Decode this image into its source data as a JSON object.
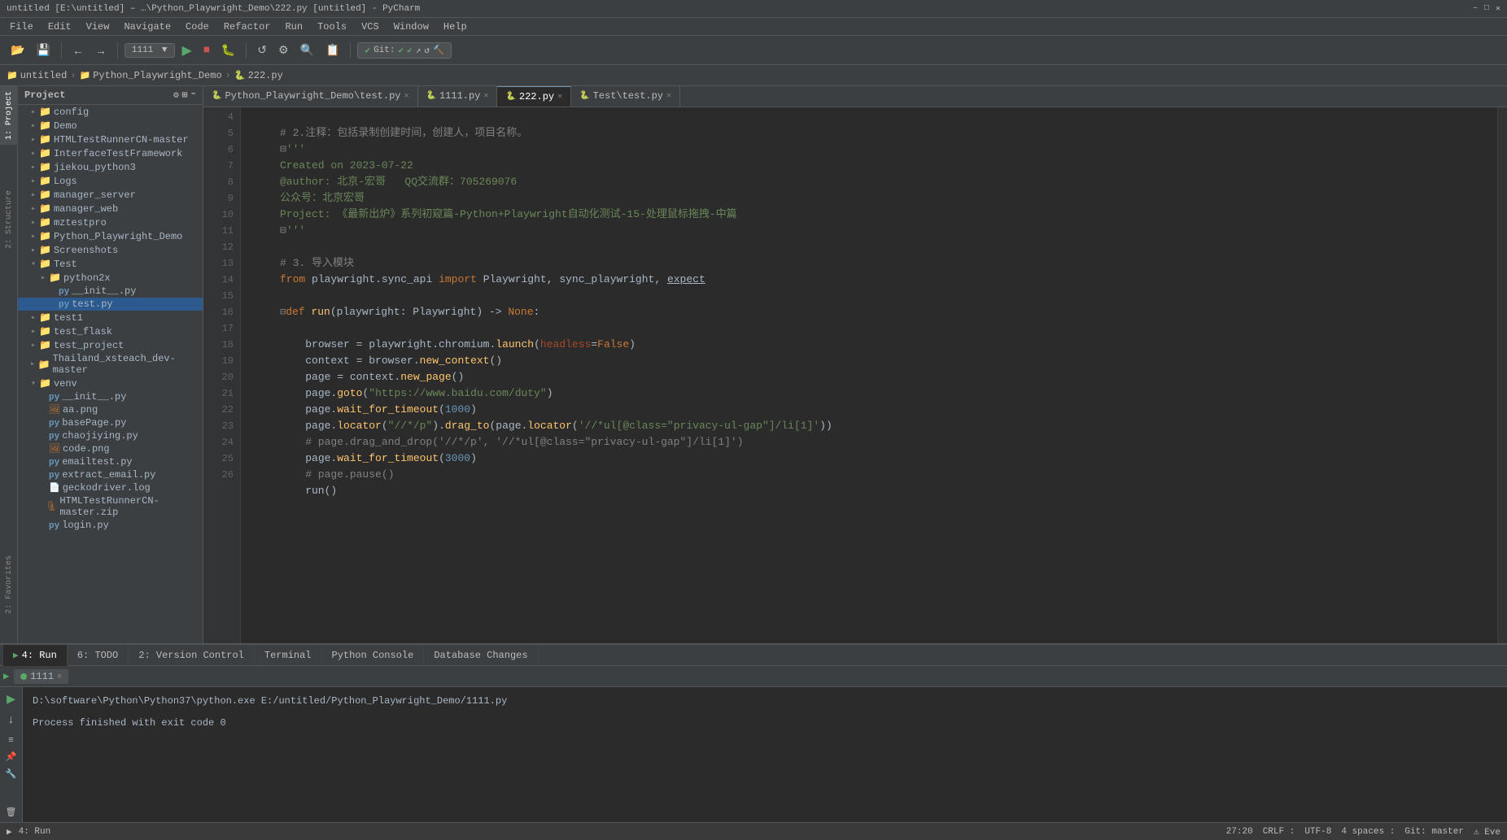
{
  "titleBar": {
    "text": "untitled [E:\\untitled] – …\\Python_Playwright_Demo\\222.py [untitled] - PyCharm",
    "controls": [
      "–",
      "□",
      "×"
    ]
  },
  "menuBar": {
    "items": [
      "File",
      "Edit",
      "View",
      "Navigate",
      "Code",
      "Refactor",
      "Run",
      "Tools",
      "VCS",
      "Window",
      "Help"
    ]
  },
  "toolbar": {
    "gitBadge": "Git:",
    "runConfig": "1111",
    "icons": [
      "←",
      "→",
      "↺",
      "▶",
      "⏹",
      "🐛",
      "⚙",
      "🔍",
      "📋"
    ]
  },
  "breadcrumb": {
    "items": [
      "untitled",
      "Python_Playwright_Demo",
      "222.py"
    ]
  },
  "projectPanel": {
    "title": "Project",
    "items": [
      {
        "label": "config",
        "type": "folder",
        "indent": 1,
        "expanded": false
      },
      {
        "label": "Demo",
        "type": "folder",
        "indent": 1,
        "expanded": false
      },
      {
        "label": "HTMLTestRunnerCN-master",
        "type": "folder",
        "indent": 1,
        "expanded": false
      },
      {
        "label": "InterfaceTestFramework",
        "type": "folder",
        "indent": 1,
        "expanded": false
      },
      {
        "label": "jiekou_python3",
        "type": "folder",
        "indent": 1,
        "expanded": false
      },
      {
        "label": "Logs",
        "type": "folder",
        "indent": 1,
        "expanded": false
      },
      {
        "label": "manager_server",
        "type": "folder",
        "indent": 1,
        "expanded": false
      },
      {
        "label": "manager_web",
        "type": "folder",
        "indent": 1,
        "expanded": false
      },
      {
        "label": "mztestpro",
        "type": "folder",
        "indent": 1,
        "expanded": false
      },
      {
        "label": "Python_Playwright_Demo",
        "type": "folder",
        "indent": 1,
        "expanded": false
      },
      {
        "label": "Screenshots",
        "type": "folder",
        "indent": 1,
        "expanded": false
      },
      {
        "label": "Test",
        "type": "folder",
        "indent": 1,
        "expanded": true
      },
      {
        "label": "python2x",
        "type": "folder",
        "indent": 2,
        "expanded": false
      },
      {
        "label": "__init__.py",
        "type": "py",
        "indent": 3,
        "expanded": false
      },
      {
        "label": "test.py",
        "type": "py",
        "indent": 3,
        "expanded": false,
        "selected": true
      },
      {
        "label": "test1",
        "type": "folder",
        "indent": 1,
        "expanded": false
      },
      {
        "label": "test_flask",
        "type": "folder",
        "indent": 1,
        "expanded": false
      },
      {
        "label": "test_project",
        "type": "folder",
        "indent": 1,
        "expanded": false
      },
      {
        "label": "Thailand_xsteach_dev-master",
        "type": "folder",
        "indent": 1,
        "expanded": false
      },
      {
        "label": "venv",
        "type": "folder",
        "indent": 1,
        "expanded": true
      },
      {
        "label": "__init__.py",
        "type": "py",
        "indent": 2,
        "expanded": false
      },
      {
        "label": "aa.png",
        "type": "png",
        "indent": 2,
        "expanded": false
      },
      {
        "label": "basePage.py",
        "type": "py",
        "indent": 2,
        "expanded": false
      },
      {
        "label": "chaojiying.py",
        "type": "py",
        "indent": 2,
        "expanded": false
      },
      {
        "label": "code.png",
        "type": "png",
        "indent": 2,
        "expanded": false
      },
      {
        "label": "emailtest.py",
        "type": "py",
        "indent": 2,
        "expanded": false
      },
      {
        "label": "extract_email.py",
        "type": "py",
        "indent": 2,
        "expanded": false
      },
      {
        "label": "geckodriver.log",
        "type": "log",
        "indent": 2,
        "expanded": false
      },
      {
        "label": "HTMLTestRunnerCN-master.zip",
        "type": "zip",
        "indent": 2,
        "expanded": false
      },
      {
        "label": "login.py",
        "type": "py",
        "indent": 2,
        "expanded": false
      }
    ]
  },
  "editorTabs": [
    {
      "label": "Python_Playwright_Demo\\test.py",
      "type": "py",
      "active": false,
      "closeable": true
    },
    {
      "label": "1111.py",
      "type": "py",
      "active": false,
      "closeable": true
    },
    {
      "label": "222.py",
      "type": "py",
      "active": true,
      "closeable": true
    },
    {
      "label": "Test\\test.py",
      "type": "py",
      "active": false,
      "closeable": true
    }
  ],
  "codeLines": [
    {
      "num": 4,
      "content": ""
    },
    {
      "num": 5,
      "content": "# 2.注释：包括录制创建时间，创建人，项目名称。"
    },
    {
      "num": 6,
      "content": "'''"
    },
    {
      "num": 7,
      "content": "Created on 2023-07-22"
    },
    {
      "num": 8,
      "content": "@author: 北京-宏哥   QQ交流群：705269076"
    },
    {
      "num": 9,
      "content": "公众号：北京宏哥"
    },
    {
      "num": 10,
      "content": "Project: 《最新出炉》系列初窥篇-Python+Playwright自动化测试-15-处理鼠标拖拽-中篇"
    },
    {
      "num": 11,
      "content": "'''"
    },
    {
      "num": 12,
      "content": ""
    },
    {
      "num": 13,
      "content": "# 3. 导入模块"
    },
    {
      "num": 14,
      "content": "from playwright.sync_api import Playwright, sync_playwright, expect"
    },
    {
      "num": 15,
      "content": ""
    },
    {
      "num": 16,
      "content": "def run(playwright: Playwright) -> None:"
    },
    {
      "num": 17,
      "content": ""
    },
    {
      "num": 18,
      "content": "    browser = playwright.chromium.launch(headless=False)"
    },
    {
      "num": 19,
      "content": "    context = browser.new_context()"
    },
    {
      "num": 20,
      "content": "    page = context.new_page()"
    },
    {
      "num": 21,
      "content": "    page.goto(\"https://www.baidu.com/duty\")"
    },
    {
      "num": 22,
      "content": "    page.wait_for_timeout(1000)"
    },
    {
      "num": 23,
      "content": "    page.locator(\"//*/p\").drag_to(page.locator('//*ul[@class=\"privacy-ul-gap\"]/li[1]'))"
    },
    {
      "num": 24,
      "content": "    # page.drag_and_drop('//*/p', '//*ul[@class=\"privacy-ul-gap\"]/li[1]')"
    },
    {
      "num": 25,
      "content": "    page.wait_for_timeout(3000)"
    },
    {
      "num": 26,
      "content": "    # page.pause()"
    }
  ],
  "bottomCode": "    run()",
  "runPanel": {
    "tabs": [
      {
        "label": "4: Run",
        "icon": "▶"
      },
      {
        "label": "6: TODO",
        "icon": ""
      },
      {
        "label": "2: Version Control",
        "icon": ""
      },
      {
        "label": "Terminal",
        "icon": ""
      },
      {
        "label": "Python Console",
        "icon": ""
      },
      {
        "label": "Database Changes",
        "icon": ""
      }
    ],
    "activeRun": "1111",
    "command": "D:\\software\\Python\\Python37\\python.exe E:/untitled/Python_Playwright_Demo/1111.py",
    "result": "Process finished with exit code 0"
  },
  "statusBar": {
    "line": "27:20",
    "lineEnding": "CRLF",
    "encoding": "UTF-8",
    "indent": "4 spaces",
    "gitBranch": "Git: master",
    "rightItems": [
      "27:20",
      "CRLF :",
      "UTF-8",
      "4 spaces :",
      "Git: master",
      "⚠ Eve"
    ]
  },
  "sidebarTabs": [
    {
      "label": "1: Project"
    },
    {
      "label": "2: Structure"
    },
    {
      "label": "Favorites"
    }
  ],
  "icons": {
    "folder": "📁",
    "pyFile": "🐍",
    "pngFile": "🖼",
    "logFile": "📄",
    "zipFile": "🗜",
    "settings": "⚙",
    "close": "✕",
    "run": "▶",
    "stop": "⏹",
    "debug": "🐛",
    "search": "🔍"
  }
}
